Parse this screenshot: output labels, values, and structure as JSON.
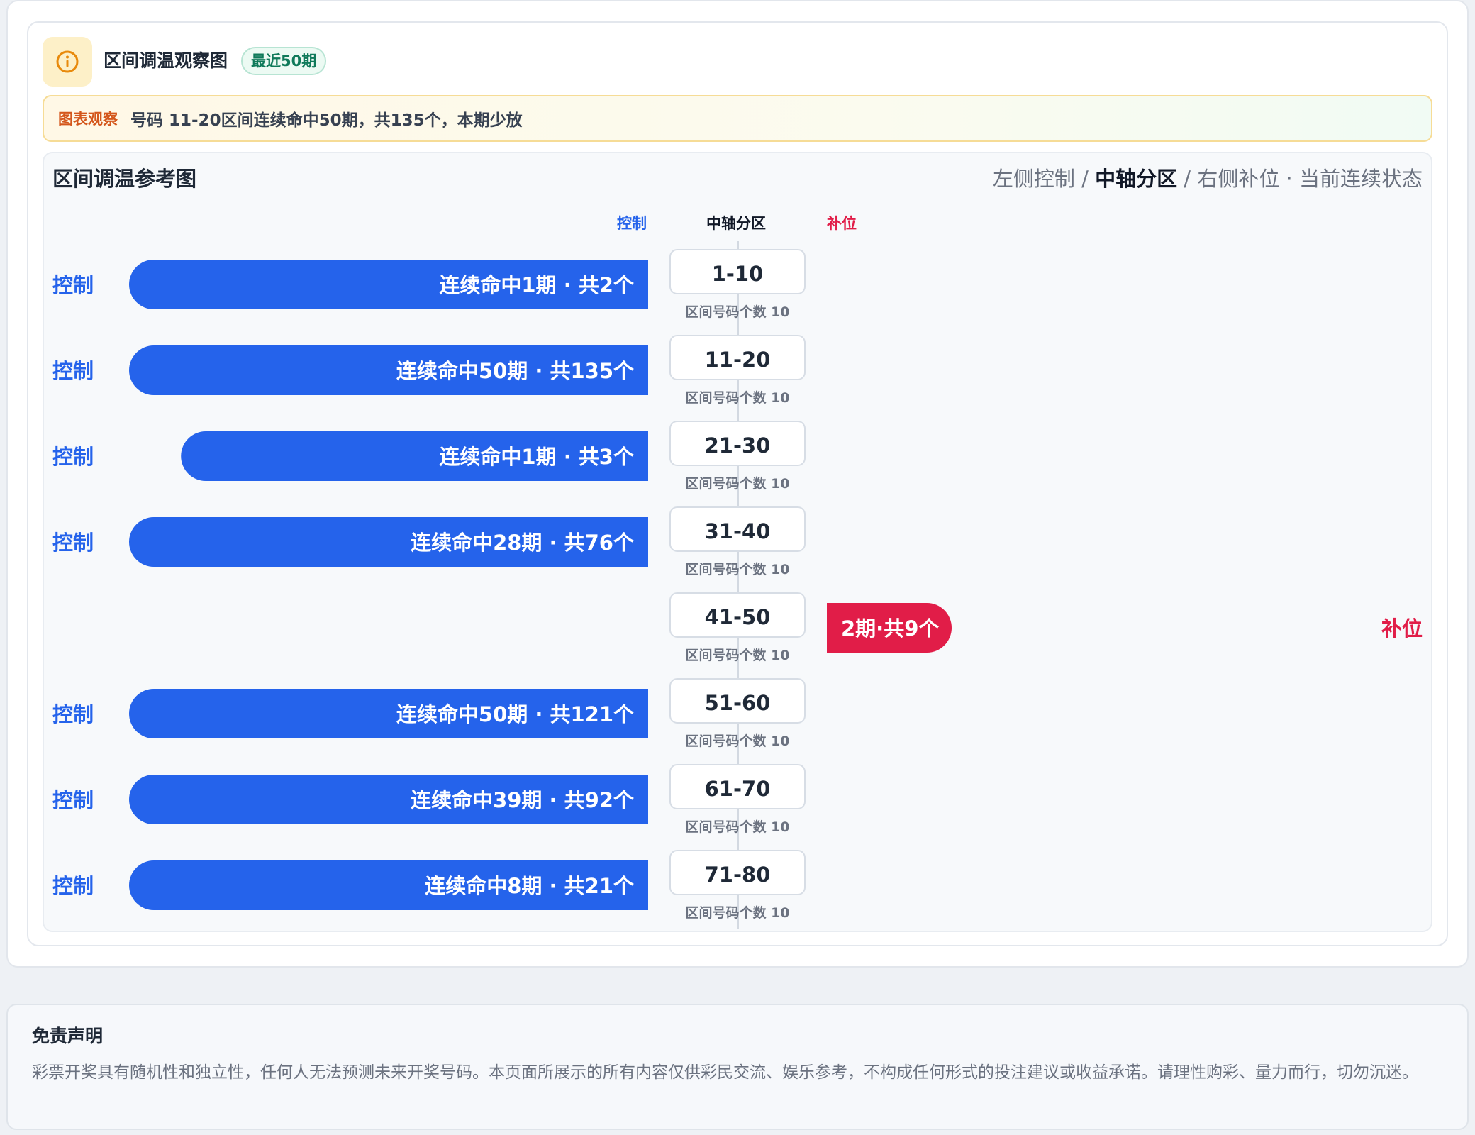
{
  "header": {
    "icon": "info-icon",
    "title": "区间调温观察图",
    "badge": "最近50期"
  },
  "observation": {
    "tag": "图表观察",
    "text": "号码 11-20区间连续命中50期，共135个，本期少放"
  },
  "panel": {
    "title": "区间调温参考图",
    "legend": {
      "left": "左侧控制",
      "sep1": " / ",
      "mid": "中轴分区",
      "sep2": " / ",
      "right": "右侧补位",
      "dot": " · ",
      "state": "当前连续状态"
    }
  },
  "colors": {
    "control": "#2563eb",
    "fill": "#e11d48",
    "axis_card_border": "#d7dde5"
  },
  "chart_data": {
    "type": "bar",
    "column_headers": {
      "left": "控制",
      "mid": "中轴分区",
      "right": "补位"
    },
    "side_labels": {
      "control": "控制",
      "fill": "补位"
    },
    "ranges": [
      {
        "range": "1-10",
        "count_label": "区间号码个数 10",
        "side": "control",
        "label": "连续命中1期 · 共2个",
        "periods": 1,
        "total": 2
      },
      {
        "range": "11-20",
        "count_label": "区间号码个数 10",
        "side": "control",
        "label": "连续命中50期 · 共135个",
        "periods": 50,
        "total": 135
      },
      {
        "range": "21-30",
        "count_label": "区间号码个数 10",
        "side": "control",
        "label": "连续命中1期 · 共3个",
        "periods": 1,
        "total": 3
      },
      {
        "range": "31-40",
        "count_label": "区间号码个数 10",
        "side": "control",
        "label": "连续命中28期 · 共76个",
        "periods": 28,
        "total": 76
      },
      {
        "range": "41-50",
        "count_label": "区间号码个数 10",
        "side": "fill",
        "label": "连续命中2期 · 共9个",
        "periods": 2,
        "total": 9
      },
      {
        "range": "51-60",
        "count_label": "区间号码个数 10",
        "side": "control",
        "label": "连续命中50期 · 共121个",
        "periods": 50,
        "total": 121
      },
      {
        "range": "61-70",
        "count_label": "区间号码个数 10",
        "side": "control",
        "label": "连续命中39期 · 共92个",
        "periods": 39,
        "total": 92
      },
      {
        "range": "71-80",
        "count_label": "区间号码个数 10",
        "side": "control",
        "label": "连续命中8期 · 共21个",
        "periods": 8,
        "total": 21
      }
    ]
  },
  "disclaimer": {
    "title": "免责声明",
    "text": "彩票开奖具有随机性和独立性，任何人无法预测未来开奖号码。本页面所展示的所有内容仅供彩民交流、娱乐参考，不构成任何形式的投注建议或收益承诺。请理性购彩、量力而行，切勿沉迷。"
  }
}
